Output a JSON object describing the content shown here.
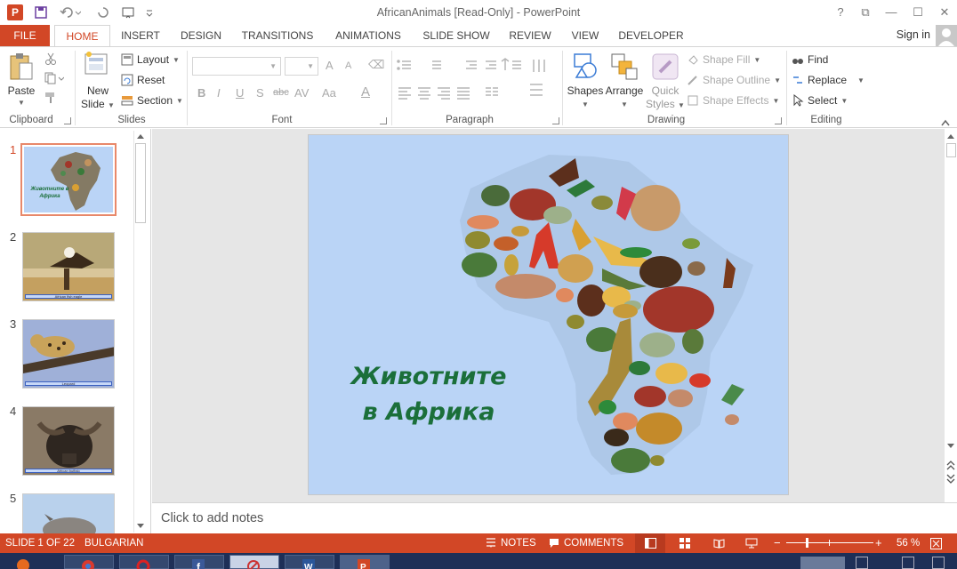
{
  "window": {
    "title": "AfricanAnimals [Read-Only] - PowerPoint",
    "logo_letter": "P",
    "controls": [
      "?",
      "⧉",
      "—",
      "☐",
      "✕"
    ]
  },
  "tabs": [
    "FILE",
    "HOME",
    "INSERT",
    "DESIGN",
    "TRANSITIONS",
    "ANIMATIONS",
    "SLIDE SHOW",
    "REVIEW",
    "VIEW",
    "DEVELOPER"
  ],
  "active_tab": "HOME",
  "account": {
    "signin": "Sign in"
  },
  "ribbon": {
    "clipboard": {
      "paste": "Paste",
      "label": "Clipboard"
    },
    "slides": {
      "new_slide_1": "New",
      "new_slide_2": "Slide",
      "layout": "Layout",
      "reset": "Reset",
      "section": "Section",
      "label": "Slides"
    },
    "font": {
      "label": "Font",
      "bold": "B",
      "italic": "I",
      "underline": "U",
      "shadow": "S",
      "strike": "abc",
      "spacing": "AV",
      "case": "Aa",
      "color": "A",
      "grow": "A",
      "shrink": "A"
    },
    "paragraph": {
      "label": "Paragraph"
    },
    "drawing": {
      "shapes": "Shapes",
      "arrange": "Arrange",
      "quick_styles_1": "Quick",
      "quick_styles_2": "Styles",
      "shape_fill": "Shape Fill",
      "shape_outline": "Shape Outline",
      "shape_effects": "Shape Effects",
      "label": "Drawing"
    },
    "editing": {
      "find": "Find",
      "replace": "Replace",
      "select": "Select",
      "label": "Editing"
    }
  },
  "thumbnails": [
    {
      "num": "1",
      "caption": "Животните в Африка",
      "selected": true
    },
    {
      "num": "2",
      "caption": "African fish eagle",
      "selected": false
    },
    {
      "num": "3",
      "caption": "Leopard",
      "selected": false
    },
    {
      "num": "4",
      "caption": "African buffalo",
      "selected": false
    },
    {
      "num": "5",
      "caption": "",
      "selected": false
    }
  ],
  "slide": {
    "title_line1": "Животните",
    "title_line2": "в Африка",
    "background": "#bad4f6",
    "title_color": "#1b6f3a"
  },
  "notes": {
    "placeholder": "Click to add notes"
  },
  "status": {
    "slide_info": "SLIDE 1 OF 22",
    "language": "BULGARIAN",
    "notes": "NOTES",
    "comments": "COMMENTS",
    "zoom": "56 %"
  },
  "colors": {
    "accent": "#d24726",
    "taskbar": "#1e2f57"
  }
}
